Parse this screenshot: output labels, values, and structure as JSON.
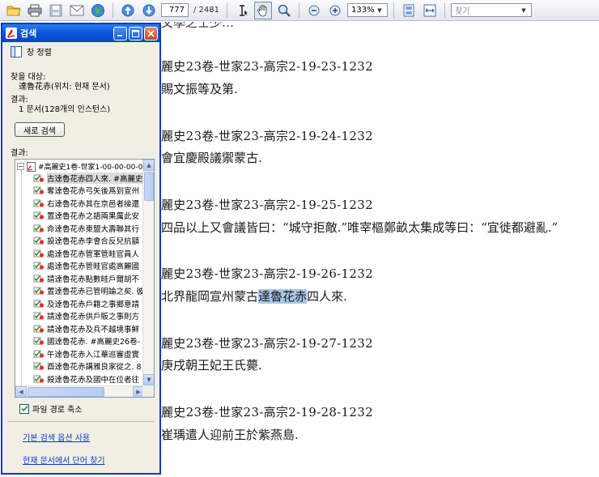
{
  "toolbar": {
    "page_current": "777",
    "page_total": "/ 2481",
    "zoom": "133%",
    "find_placeholder": "찾기"
  },
  "document": {
    "top_fragment": "文學之士少…",
    "entries": [
      {
        "ref": "麗史23卷-世家23-高宗2-19-23-1232",
        "text": "賜文振等及第."
      },
      {
        "ref": "麗史23卷-世家23-高宗2-19-24-1232",
        "text": "會宜慶殿議禦蒙古."
      },
      {
        "ref": "麗史23卷-世家23-高宗2-19-25-1232",
        "text": "四品以上又會議皆曰：“城守拒敵.”唯宰樞鄭畝太集成等曰：“宜徙都避亂.”"
      },
      {
        "ref": "麗史23卷-世家23-高宗2-19-26-1232",
        "text_before": "北界龍岡宣州蒙古",
        "text_hl": "達魯花赤",
        "text_after": "四人來."
      },
      {
        "ref": "麗史23卷-世家23-高宗2-19-27-1232",
        "text": "庚戌朝王妃王氏薨."
      },
      {
        "ref": "麗史23卷-世家23-高宗2-19-28-1232",
        "text": "崔瑀遣人迎前王於紫燕島."
      }
    ]
  },
  "panel": {
    "title": "검색",
    "arrange_label": "창 정렬",
    "search_target_label": "찾을 대상:",
    "search_target_value": "達魯花赤(위치: 현재 문서)",
    "results_label": "결과:",
    "results_value": "1 문서(128개의 인스턴스)",
    "new_search_button": "새로 검색",
    "results_list_label": "결과:",
    "results_root": "#高麗史1卷-世家1-00-00-00-000",
    "results": [
      "古達魯花赤四人來. #高麗史",
      "奪達魯花赤弓矢後爲到宣州",
      "右達魯花赤其在京邑者接還",
      "置達魯花赤之語兩果厲此安",
      "命達魯花赤東盟大壽聯其行",
      "設達魯花赤李會合反兒抗額",
      "處達魯花赤管軍管畦官員人",
      "處達魯花赤管畦官處高麗國",
      "請達魯花赤點數畦戶爾胡不",
      "置達魯花赤已管明論之矣. 彼",
      "及達魯花赤戶籍之事鄉意請",
      "請達魯花赤供戶販之事則方",
      "請達魯花赤及兵不越境事鮮",
      "國達魯花赤. #高麗史26卷-",
      "午達魯花赤入江華巡審虛實",
      "酉達魯花赤講雅良家從之. 8",
      "殺達魯花赤及國中在位者往"
    ],
    "show_path_label": "파일 경로 축소",
    "basic_options_link": "기본 검색 옵션 사용",
    "find_in_doc_link": "현재 문서에서 단어 찾기"
  }
}
